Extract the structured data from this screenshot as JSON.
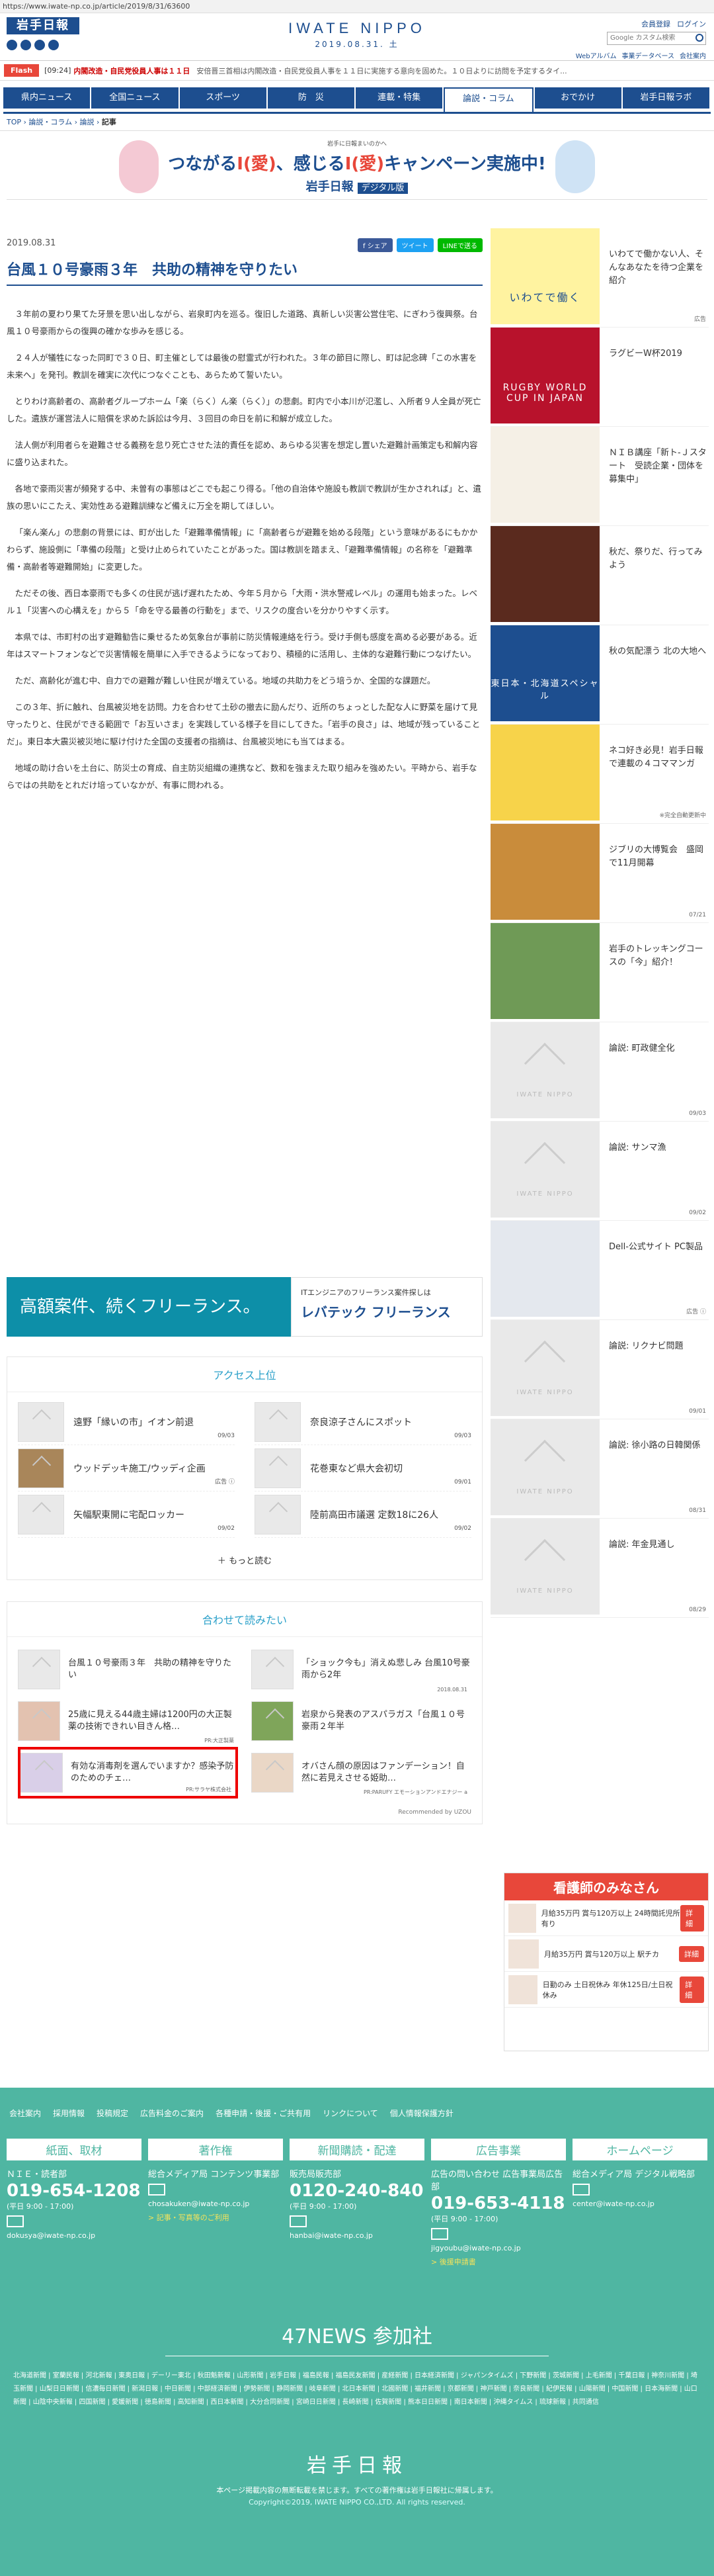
{
  "url": "https://www.iwate-np.co.jp/article/2019/8/31/63600",
  "header": {
    "logo_text": "岩手日報",
    "brand": "IWATE NIPPO",
    "date": "2019.08.31. 土",
    "top_links": [
      "会員登録",
      "ログイン"
    ],
    "search_placeholder": "Google カスタム検索",
    "sub_links": [
      "Webアルバム",
      "事業データベース",
      "会社案内"
    ]
  },
  "flash": {
    "tag": "Flash",
    "time": "[09:24]",
    "headline": "内閣改造・自民党役員人事は１１日",
    "rest": "安倍晋三首相は内閣改造・自民党役員人事を１１日に実施する意向を固めた。１０日よりに訪問を予定するタイ..."
  },
  "nav": [
    "県内ニュース",
    "全国ニュース",
    "スポーツ",
    "防　災",
    "連載・特集",
    "論説・コラム",
    "おでかけ",
    "岩手日報ラボ"
  ],
  "nav_active": 5,
  "breadcrumb": {
    "items": [
      "TOP",
      "論説・コラム",
      "論説"
    ],
    "current": "記事"
  },
  "banner": {
    "small": "岩手に日報まいのかへ",
    "big": "つながる",
    "big_em1": "I(愛)",
    "big_mid": "、感じる",
    "big_em2": "I(愛)",
    "big_end": "キャンペーン実施中!",
    "brand": "岩手日報",
    "brand_tag": "デジタル版"
  },
  "article": {
    "date": "2019.08.31",
    "share": [
      "f シェア",
      "ツイート",
      "LINEで送る"
    ],
    "title": "台風１０号豪雨３年　共助の精神を守りたい",
    "paragraphs": [
      "３年前の夏わり果てた牙景を思い出しながら、岩泉町内を巡る。復旧した道路、真新しい災害公営住宅、にぎわう復興祭。台風１０号豪雨からの復興の確かな歩みを感じる。",
      "２４人が犠牲になった同町で３０日、町主催としては最後の慰霊式が行われた。３年の節目に際し、町は記念碑「この水害を未来へ」を発刊。教訓を確実に次代につなぐことも、あらためて誓いたい。",
      "とりわけ高齢者の、高齢者グループホーム「楽（らく）ん楽（らく）」の悲劇。町内で小本川が氾濫し、入所者９人全員が死亡した。遺族が運営法人に賠償を求めた訴訟は今月、３回目の命日を前に和解が成立した。",
      "法人側が利用者らを避難させる義務を怠り死亡させた法的責任を認め、あらゆる災害を想定し置いた避難計画策定も和解内容に盛り込まれた。",
      "各地で豪雨災害が頻発する中、未曽有の事態はどこでも起こり得る。「他の自治体や施設も教訓で教訓が生かされれば」と、遺族の思いにこたえ、実効性ある避難訓練など備えに万全を期してほしい。",
      "「楽ん楽ん」の悲劇の背景には、町が出した「避難準備情報」に「高齢者らが避難を始める段階」という意味があるにもかかわらず、施設側に「準備の段階」と受け止められていたことがあった。国は教訓を踏まえ、「避難準備情報」の名称を「避難準備・高齢者等避難開始」に変更した。",
      "ただその後、西日本豪雨でも多くの住民が逃げ遅れたため、今年５月から「大雨・洪水警戒レベル」の運用も始まった。レベル１「災害への心構えを」から５「命を守る最善の行動を」まで、リスクの度合いを分かりやすく示す。",
      "本県では、市町村の出す避難勧告に乗せるため気象台が事前に防災情報連絡を行う。受け手側も感度を高める必要がある。近年はスマートフォンなどで災害情報を簡単に入手できるようになっており、積極的に活用し、主体的な避難行動につなげたい。",
      "ただ、高齢化が進む中、自力での避難が難しい住民が増えている。地域の共助力をどう培うか、全国的な課題だ。",
      "この３年、折に触れ、台風被災地を訪問。力を合わせて土砂の撤去に励んだり、近所のちょっとした配な人に野菜を届けて見守ったりと、住民ができる範囲で「お互いさま」を実践している様子を目にしてきた。「岩手の良さ」は、地域が残っていることだ」。東日本大震災被災地に駆け付けた全国の支援者の指摘は、台風被災地にも当てはまる。",
      "地域の助け合いを土台に、防災士の育成、自主防災組織の連携など、数和を強まえた取り組みを強めたい。平時から、岩手ならではの共助をとれだけ培っていなかが、有事に問われる。"
    ]
  },
  "ad_wide": {
    "left": "高額案件、続くフリーランス。",
    "right_small": "ITエンジニアのフリーランス案件探しは",
    "right_brand": "レバテック フリーランス"
  },
  "access": {
    "title": "アクセス上位",
    "items": [
      {
        "text": "遠野「縁いの市」イオン前退",
        "date": "09/03"
      },
      {
        "text": "奈良涼子さんにスポット",
        "date": "09/03"
      },
      {
        "text": "ウッドデッキ施工/ウッディ企画",
        "date": "広告 ⓘ"
      },
      {
        "text": "花巻東など県大会初切",
        "date": "09/01"
      },
      {
        "text": "矢幅駅東開に宅配ロッカー",
        "date": "09/02"
      },
      {
        "text": "陸前高田市議選 定数18に26人",
        "date": "09/02"
      }
    ],
    "more": "もっと読む"
  },
  "related": {
    "title": "合わせて読みたい",
    "items": [
      {
        "text": "台風１０号豪雨３年　共助の精神を守りたい",
        "sub": ""
      },
      {
        "text": "「ショック今も」消えぬ悲しみ 台風10号豪雨から2年",
        "sub": "2018.08.31"
      },
      {
        "text": "25歳に見える44歳主婦は1200円の大正製薬の技術できれい目きん格…",
        "sub": "PR:大正製薬"
      },
      {
        "text": "岩泉から発表のアスパラガス「台風１０号豪雨２年半",
        "sub": ""
      },
      {
        "text": "有効な消毒剤を選んでいますか？感染予防のためのチェ…",
        "sub": "PR:サラヤ株式会社"
      },
      {
        "text": "オバさん顔の原因はファンデーション！自然に若見えさせる姫助…",
        "sub": "PR:PARUFY エモーションアンドエナジー a"
      }
    ],
    "recommend": "Recommended by UZOU"
  },
  "sidebar": [
    {
      "text": "いわてで働かない人、そんなあなたを待つ企業を紹介",
      "date": "広告",
      "img": "いわてで働く"
    },
    {
      "text": "ラグビーW杯2019",
      "date": "",
      "img": "RUGBY WORLD CUP IN JAPAN"
    },
    {
      "text": "ＮＩＢ講座「新ト-Ｊスタート　受読企業・団体を募集中」",
      "date": "",
      "img": ""
    },
    {
      "text": "秋だ、祭りだ、行ってみよう",
      "date": "",
      "img": ""
    },
    {
      "text": "秋の気配漂う 北の大地へ",
      "date": "",
      "img": "東日本・北海道スペシャル"
    },
    {
      "text": "ネコ好き必見！岩手日報で連載の４コママンガ",
      "date": "※完全自動更新中",
      "img": ""
    },
    {
      "text": "ジブリの大博覧会　盛岡で11月開幕",
      "date": "07/21",
      "img": ""
    },
    {
      "text": "岩手のトレッキングコースの「今」紹介！",
      "date": "",
      "img": ""
    },
    {
      "text": "論説: 町政健全化",
      "date": "09/03",
      "img": "IWATE NIPPO"
    },
    {
      "text": "論説: サンマ漁",
      "date": "09/02",
      "img": "IWATE NIPPO"
    },
    {
      "text": "Dell-公式サイト PC製品",
      "date": "広告 ⓘ",
      "img": ""
    },
    {
      "text": "論説: リクナビ問題",
      "date": "09/01",
      "img": "IWATE NIPPO"
    },
    {
      "text": "論説: 徐小路の日韓関係",
      "date": "08/31",
      "img": "IWATE NIPPO"
    },
    {
      "text": "論説: 年金見通し",
      "date": "08/29",
      "img": "IWATE NIPPO"
    }
  ],
  "nurse": {
    "title": "看護師のみなさん",
    "rows": [
      {
        "text": "月給35万円 賞与120万以上 24時間託児所有り",
        "btn": "詳細"
      },
      {
        "text": "月給35万円 賞与120万以上 駅チカ",
        "btn": "詳細"
      },
      {
        "text": "日勤のみ 土日祝休み 年休125日/土日祝休み",
        "btn": "詳細"
      }
    ]
  },
  "footer": {
    "links": [
      "会社案内",
      "採用情報",
      "投稿規定",
      "広告料金のご案内",
      "各種申請・後援・ご共有用",
      "リンクについて",
      "個人情報保護方針"
    ],
    "cols": [
      {
        "h": "紙面、取材",
        "t": "ＮＩＥ・読者部",
        "phone": "019-654-1208",
        "hrs": "(平日 9:00 - 17:00)",
        "mail": "dokusya@iwate-np.co.jp",
        "lnk": ""
      },
      {
        "h": "著作権",
        "t": "総合メディア局 コンテンツ事業部",
        "phone": "",
        "hrs": "",
        "mail": "chosakuken@iwate-np.co.jp",
        "lnk": "> 記事・写真等のご利用"
      },
      {
        "h": "新聞購読・配達",
        "t": "販売局販売部",
        "phone": "0120-240-840",
        "hrs": "(平日 9:00 - 17:00)",
        "mail": "hanbai@iwate-np.co.jp",
        "lnk": ""
      },
      {
        "h": "広告事業",
        "t": "広告の問い合わせ 広告事業局広告部",
        "phone": "019-653-4118",
        "hrs": "(平日 9:00 - 17:00)",
        "mail": "jigyoubu@iwate-np.co.jp",
        "lnk": "> 後援申請書"
      },
      {
        "h": "ホームページ",
        "t": "総合メディア局 デジタル戦略部",
        "phone": "",
        "hrs": "",
        "mail": "center@iwate-np.co.jp",
        "lnk": ""
      }
    ],
    "news47": "47NEWS 参加社",
    "papers": "北海道新聞 | 室蘭民報 | 河北新報 | 東奥日報 | デーリー東北 | 秋田魁新報 | 山形新聞 | 岩手日報 | 福島民報 | 福島民友新聞 | 産経新聞 | 日本経済新聞 | ジャパンタイムズ | 下野新聞 | 茨城新聞 | 上毛新聞 | 千葉日報 | 神奈川新聞 | 埼玉新聞 | 山梨日日新聞 | 信濃毎日新聞 | 新潟日報 | 中日新聞 | 中部経済新聞 | 伊勢新聞 | 静岡新聞 | 岐阜新聞 | 北日本新聞 | 北國新聞 | 福井新聞 | 京都新聞 | 神戸新聞 | 奈良新聞 | 紀伊民報 | 山陽新聞 | 中国新聞 | 日本海新聞 | 山口新聞 | 山陰中央新報 | 四国新聞 | 愛媛新聞 | 徳島新聞 | 高知新聞 | 西日本新聞 | 大分合同新聞 | 宮崎日日新聞 | 長崎新聞 | 佐賀新聞 | 熊本日日新聞 | 南日本新聞 | 沖縄タイムス | 琉球新報 | 共同通信",
    "logo": "岩手日報",
    "copy1": "本ページ掲載内容の無断転載を禁じます。すべての著作権は岩手日報社に帰属します。",
    "copy2": "Copyright©2019, IWATE NIPPO CO.,LTD. All rights reserved."
  }
}
